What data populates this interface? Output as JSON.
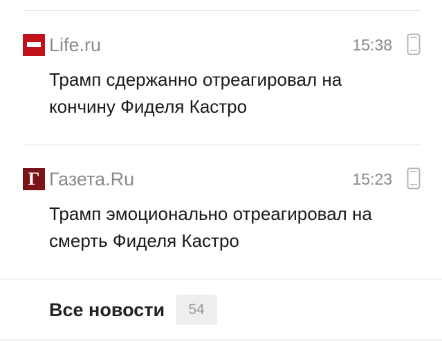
{
  "news": [
    {
      "source": "Life.ru",
      "logo_icon": "life-ru-logo",
      "time": "15:38",
      "device_icon": "mobile-phone-icon",
      "headline": "Трамп сдержанно отреагировал на кончину Фиделя Кастро"
    },
    {
      "source": "Газета.Ru",
      "logo_icon": "gazeta-ru-logo",
      "logo_letter": "Г",
      "time": "15:23",
      "device_icon": "mobile-phone-icon",
      "headline": "Трамп эмоционально отреагировал на смерть Фиделя Кастро"
    }
  ],
  "footer": {
    "all_news_label": "Все новости",
    "count": "54"
  },
  "colors": {
    "life_red": "#c1121c",
    "gazeta_red": "#7a1418",
    "meta_gray": "#8a8a8a",
    "divider": "#dcdcdc",
    "badge_bg": "#eeeeee"
  }
}
